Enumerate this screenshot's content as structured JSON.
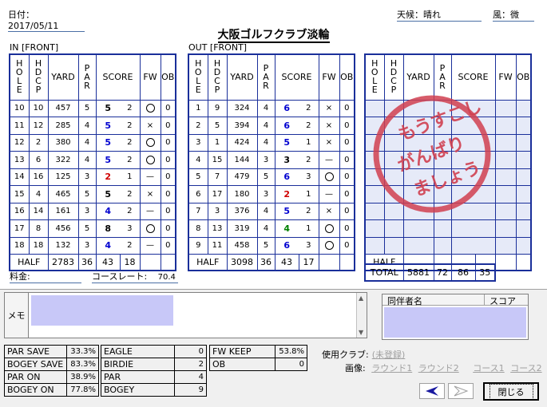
{
  "header": {
    "date": "日付：2017/05/11",
    "weather": "天候：晴れ",
    "wind": "風：微",
    "title": "大阪ゴルフクラブ淡輪"
  },
  "cols": {
    "hole": "HOLE",
    "hdcp": "HDCP",
    "yard": "YARD",
    "par": "PAR",
    "score": "SCORE",
    "fw": "FW",
    "ob": "OB"
  },
  "in": {
    "label": "IN [FRONT]",
    "rows": [
      {
        "hole": "10",
        "hdcp": "10",
        "yard": "457",
        "par": "5",
        "score": "5",
        "putt": "2",
        "fw": "○",
        "ob": "0",
        "color": "black"
      },
      {
        "hole": "11",
        "hdcp": "12",
        "yard": "285",
        "par": "4",
        "score": "5",
        "putt": "2",
        "fw": "×",
        "ob": "0",
        "color": "blue"
      },
      {
        "hole": "12",
        "hdcp": "2",
        "yard": "380",
        "par": "4",
        "score": "5",
        "putt": "2",
        "fw": "○",
        "ob": "0",
        "color": "blue"
      },
      {
        "hole": "13",
        "hdcp": "6",
        "yard": "322",
        "par": "4",
        "score": "5",
        "putt": "2",
        "fw": "○",
        "ob": "0",
        "color": "blue"
      },
      {
        "hole": "14",
        "hdcp": "16",
        "yard": "125",
        "par": "3",
        "score": "2",
        "putt": "1",
        "fw": "—",
        "ob": "0",
        "color": "red"
      },
      {
        "hole": "15",
        "hdcp": "4",
        "yard": "465",
        "par": "5",
        "score": "5",
        "putt": "2",
        "fw": "×",
        "ob": "0",
        "color": "black"
      },
      {
        "hole": "16",
        "hdcp": "14",
        "yard": "161",
        "par": "3",
        "score": "4",
        "putt": "2",
        "fw": "—",
        "ob": "0",
        "color": "blue"
      },
      {
        "hole": "17",
        "hdcp": "8",
        "yard": "456",
        "par": "5",
        "score": "8",
        "putt": "3",
        "fw": "○",
        "ob": "0",
        "color": "black"
      },
      {
        "hole": "18",
        "hdcp": "18",
        "yard": "132",
        "par": "3",
        "score": "4",
        "putt": "2",
        "fw": "—",
        "ob": "0",
        "color": "blue"
      }
    ],
    "half": {
      "label": "HALF",
      "yard": "2783",
      "par": "36",
      "score": "43",
      "putt": "18"
    }
  },
  "out": {
    "label": "OUT [FRONT]",
    "rows": [
      {
        "hole": "1",
        "hdcp": "9",
        "yard": "324",
        "par": "4",
        "score": "6",
        "putt": "2",
        "fw": "×",
        "ob": "0",
        "color": "blue"
      },
      {
        "hole": "2",
        "hdcp": "5",
        "yard": "394",
        "par": "4",
        "score": "6",
        "putt": "2",
        "fw": "×",
        "ob": "0",
        "color": "blue"
      },
      {
        "hole": "3",
        "hdcp": "1",
        "yard": "424",
        "par": "4",
        "score": "5",
        "putt": "1",
        "fw": "×",
        "ob": "0",
        "color": "blue"
      },
      {
        "hole": "4",
        "hdcp": "15",
        "yard": "144",
        "par": "3",
        "score": "3",
        "putt": "2",
        "fw": "—",
        "ob": "0",
        "color": "black"
      },
      {
        "hole": "5",
        "hdcp": "7",
        "yard": "479",
        "par": "5",
        "score": "6",
        "putt": "3",
        "fw": "○",
        "ob": "0",
        "color": "blue"
      },
      {
        "hole": "6",
        "hdcp": "17",
        "yard": "180",
        "par": "3",
        "score": "2",
        "putt": "1",
        "fw": "—",
        "ob": "0",
        "color": "red"
      },
      {
        "hole": "7",
        "hdcp": "3",
        "yard": "376",
        "par": "4",
        "score": "5",
        "putt": "2",
        "fw": "×",
        "ob": "0",
        "color": "blue"
      },
      {
        "hole": "8",
        "hdcp": "13",
        "yard": "319",
        "par": "4",
        "score": "4",
        "putt": "1",
        "fw": "○",
        "ob": "0",
        "color": "green"
      },
      {
        "hole": "9",
        "hdcp": "11",
        "yard": "458",
        "par": "5",
        "score": "6",
        "putt": "3",
        "fw": "○",
        "ob": "0",
        "color": "blue"
      }
    ],
    "half": {
      "label": "HALF",
      "yard": "3098",
      "par": "36",
      "score": "43",
      "putt": "17"
    }
  },
  "third": {
    "half_label": "HALF"
  },
  "total": {
    "label": "TOTAL",
    "yard": "5881",
    "par": "72",
    "score": "86",
    "putt": "35"
  },
  "stamp_text": "もうすこしがんばりましょう",
  "fee_label": "料金:",
  "course_rate_label": "コースレート:",
  "course_rate": "70.4",
  "memo_label": "メモ",
  "companion": {
    "name_header": "同伴者名",
    "score_header": "スコア"
  },
  "stats1": [
    {
      "label": "PAR SAVE",
      "value": "33.3%"
    },
    {
      "label": "BOGEY SAVE",
      "value": "83.3%"
    },
    {
      "label": "PAR ON",
      "value": "38.9%"
    },
    {
      "label": "BOGEY ON",
      "value": "77.8%"
    }
  ],
  "stats2": [
    {
      "label": "EAGLE",
      "value": "0"
    },
    {
      "label": "BIRDIE",
      "value": "2"
    },
    {
      "label": "PAR",
      "value": "4"
    },
    {
      "label": "BOGEY",
      "value": "9"
    }
  ],
  "stats3": [
    {
      "label": "FW KEEP",
      "value": "53.8%"
    },
    {
      "label": "OB",
      "value": "0"
    }
  ],
  "club": {
    "label": "使用クラブ:",
    "link": "(未登録)"
  },
  "images": {
    "label": "画像:",
    "links": [
      "ラウンド1",
      "ラウンド2",
      "コース1",
      "コース2"
    ]
  },
  "buttons": {
    "close": "閉じる"
  },
  "colors": {
    "grid": "#1a2f9a",
    "blue": "#0000d0",
    "red": "#d00000",
    "green": "#008000",
    "stamp": "#d04050"
  }
}
